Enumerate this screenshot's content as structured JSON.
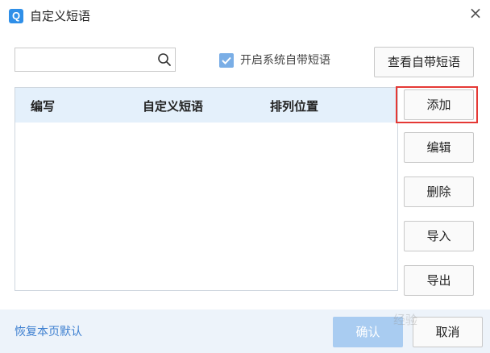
{
  "window": {
    "icon_letter": "Q",
    "title": "自定义短语",
    "close_symbol": "×"
  },
  "search": {
    "value": "",
    "placeholder": ""
  },
  "system_phrases_checkbox": {
    "checked": true,
    "label": "开启系统自带短语"
  },
  "toolbar": {
    "view_builtin_label": "查看自带短语"
  },
  "table": {
    "columns": [
      "编写",
      "自定义短语",
      "排列位置"
    ],
    "rows": []
  },
  "side_buttons": {
    "add": "添加",
    "edit": "编辑",
    "delete": "删除",
    "import": "导入",
    "export": "导出"
  },
  "footer": {
    "restore_label": "恢复本页默认",
    "ok_label": "确认",
    "cancel_label": "取消"
  },
  "watermark": "经验",
  "colors": {
    "accent": "#2f8fe8",
    "header_bg": "#e4f0fb",
    "footer_bg": "#edf3fa",
    "link": "#3d7fd0",
    "highlight": "#e53935",
    "ok_disabled": "#a9ccf1"
  }
}
